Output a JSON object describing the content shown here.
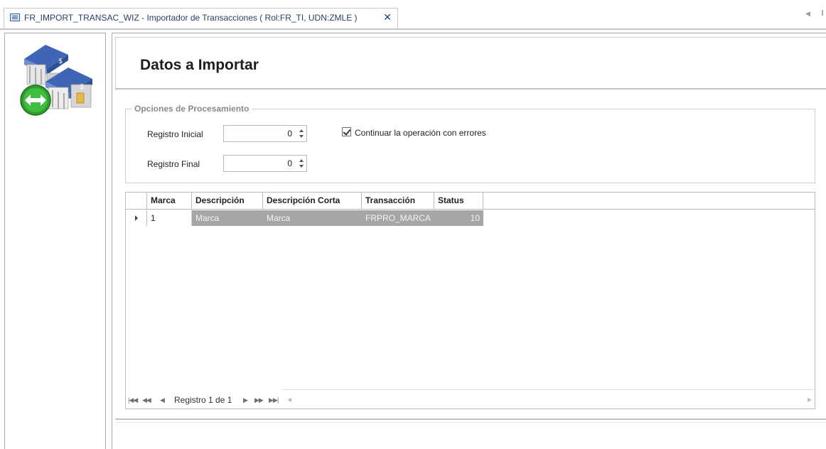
{
  "tab": {
    "title": "FR_IMPORT_TRANSAC_WIZ - Importador de Transacciones ( Rol:FR_TI, UDN:ZMLE )",
    "close_glyph": "✕"
  },
  "page": {
    "title": "Datos a Importar"
  },
  "options": {
    "legend": "Opciones de Procesamiento",
    "registro_inicial_label": "Registro Inicial",
    "registro_inicial_value": "0",
    "registro_final_label": "Registro Final",
    "registro_final_value": "0",
    "continuar_label": "Continuar la operación  con errores",
    "continuar_checked": true
  },
  "grid": {
    "columns": [
      "Marca",
      "Descripción",
      "Descripción Corta",
      "Transacción",
      "Status"
    ],
    "rows": [
      {
        "marca": "1",
        "descripcion": "Marca",
        "descripcion_corta": "Marca",
        "transaccion": "FRPRO_MARCA",
        "status": "10"
      }
    ]
  },
  "navigator": {
    "record_text": "Registro 1 de 1",
    "icons": [
      "first-icon",
      "prev-page-icon",
      "prev-icon",
      "next-icon",
      "next-page-icon",
      "last-icon"
    ]
  },
  "colors": {
    "selection": "#a6a6a6",
    "tab_title": "#2a3e66",
    "accent_blue": "#1c3f87"
  }
}
